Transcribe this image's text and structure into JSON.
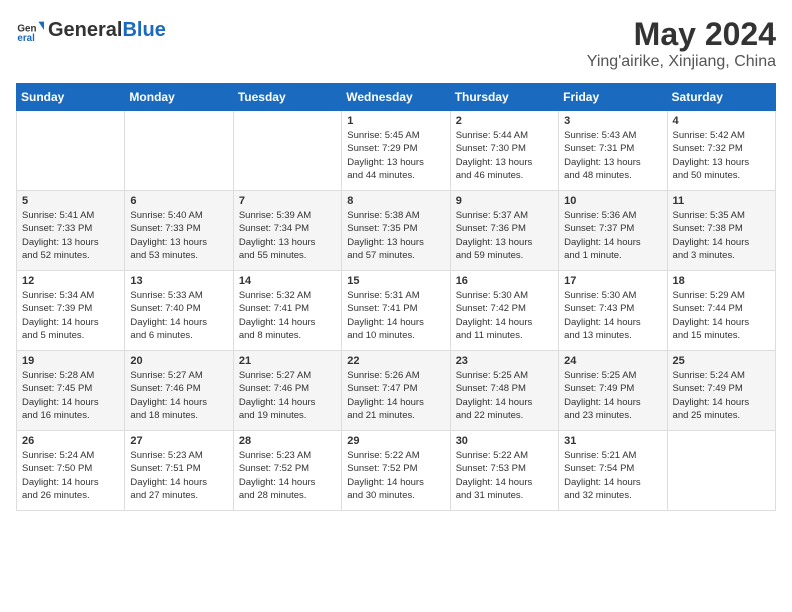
{
  "header": {
    "logo_general": "General",
    "logo_blue": "Blue",
    "month_year": "May 2024",
    "location": "Ying'airike, Xinjiang, China"
  },
  "weekdays": [
    "Sunday",
    "Monday",
    "Tuesday",
    "Wednesday",
    "Thursday",
    "Friday",
    "Saturday"
  ],
  "weeks": [
    [
      {
        "day": "",
        "info": ""
      },
      {
        "day": "",
        "info": ""
      },
      {
        "day": "",
        "info": ""
      },
      {
        "day": "1",
        "info": "Sunrise: 5:45 AM\nSunset: 7:29 PM\nDaylight: 13 hours\nand 44 minutes."
      },
      {
        "day": "2",
        "info": "Sunrise: 5:44 AM\nSunset: 7:30 PM\nDaylight: 13 hours\nand 46 minutes."
      },
      {
        "day": "3",
        "info": "Sunrise: 5:43 AM\nSunset: 7:31 PM\nDaylight: 13 hours\nand 48 minutes."
      },
      {
        "day": "4",
        "info": "Sunrise: 5:42 AM\nSunset: 7:32 PM\nDaylight: 13 hours\nand 50 minutes."
      }
    ],
    [
      {
        "day": "5",
        "info": "Sunrise: 5:41 AM\nSunset: 7:33 PM\nDaylight: 13 hours\nand 52 minutes."
      },
      {
        "day": "6",
        "info": "Sunrise: 5:40 AM\nSunset: 7:33 PM\nDaylight: 13 hours\nand 53 minutes."
      },
      {
        "day": "7",
        "info": "Sunrise: 5:39 AM\nSunset: 7:34 PM\nDaylight: 13 hours\nand 55 minutes."
      },
      {
        "day": "8",
        "info": "Sunrise: 5:38 AM\nSunset: 7:35 PM\nDaylight: 13 hours\nand 57 minutes."
      },
      {
        "day": "9",
        "info": "Sunrise: 5:37 AM\nSunset: 7:36 PM\nDaylight: 13 hours\nand 59 minutes."
      },
      {
        "day": "10",
        "info": "Sunrise: 5:36 AM\nSunset: 7:37 PM\nDaylight: 14 hours\nand 1 minute."
      },
      {
        "day": "11",
        "info": "Sunrise: 5:35 AM\nSunset: 7:38 PM\nDaylight: 14 hours\nand 3 minutes."
      }
    ],
    [
      {
        "day": "12",
        "info": "Sunrise: 5:34 AM\nSunset: 7:39 PM\nDaylight: 14 hours\nand 5 minutes."
      },
      {
        "day": "13",
        "info": "Sunrise: 5:33 AM\nSunset: 7:40 PM\nDaylight: 14 hours\nand 6 minutes."
      },
      {
        "day": "14",
        "info": "Sunrise: 5:32 AM\nSunset: 7:41 PM\nDaylight: 14 hours\nand 8 minutes."
      },
      {
        "day": "15",
        "info": "Sunrise: 5:31 AM\nSunset: 7:41 PM\nDaylight: 14 hours\nand 10 minutes."
      },
      {
        "day": "16",
        "info": "Sunrise: 5:30 AM\nSunset: 7:42 PM\nDaylight: 14 hours\nand 11 minutes."
      },
      {
        "day": "17",
        "info": "Sunrise: 5:30 AM\nSunset: 7:43 PM\nDaylight: 14 hours\nand 13 minutes."
      },
      {
        "day": "18",
        "info": "Sunrise: 5:29 AM\nSunset: 7:44 PM\nDaylight: 14 hours\nand 15 minutes."
      }
    ],
    [
      {
        "day": "19",
        "info": "Sunrise: 5:28 AM\nSunset: 7:45 PM\nDaylight: 14 hours\nand 16 minutes."
      },
      {
        "day": "20",
        "info": "Sunrise: 5:27 AM\nSunset: 7:46 PM\nDaylight: 14 hours\nand 18 minutes."
      },
      {
        "day": "21",
        "info": "Sunrise: 5:27 AM\nSunset: 7:46 PM\nDaylight: 14 hours\nand 19 minutes."
      },
      {
        "day": "22",
        "info": "Sunrise: 5:26 AM\nSunset: 7:47 PM\nDaylight: 14 hours\nand 21 minutes."
      },
      {
        "day": "23",
        "info": "Sunrise: 5:25 AM\nSunset: 7:48 PM\nDaylight: 14 hours\nand 22 minutes."
      },
      {
        "day": "24",
        "info": "Sunrise: 5:25 AM\nSunset: 7:49 PM\nDaylight: 14 hours\nand 23 minutes."
      },
      {
        "day": "25",
        "info": "Sunrise: 5:24 AM\nSunset: 7:49 PM\nDaylight: 14 hours\nand 25 minutes."
      }
    ],
    [
      {
        "day": "26",
        "info": "Sunrise: 5:24 AM\nSunset: 7:50 PM\nDaylight: 14 hours\nand 26 minutes."
      },
      {
        "day": "27",
        "info": "Sunrise: 5:23 AM\nSunset: 7:51 PM\nDaylight: 14 hours\nand 27 minutes."
      },
      {
        "day": "28",
        "info": "Sunrise: 5:23 AM\nSunset: 7:52 PM\nDaylight: 14 hours\nand 28 minutes."
      },
      {
        "day": "29",
        "info": "Sunrise: 5:22 AM\nSunset: 7:52 PM\nDaylight: 14 hours\nand 30 minutes."
      },
      {
        "day": "30",
        "info": "Sunrise: 5:22 AM\nSunset: 7:53 PM\nDaylight: 14 hours\nand 31 minutes."
      },
      {
        "day": "31",
        "info": "Sunrise: 5:21 AM\nSunset: 7:54 PM\nDaylight: 14 hours\nand 32 minutes."
      },
      {
        "day": "",
        "info": ""
      }
    ]
  ]
}
